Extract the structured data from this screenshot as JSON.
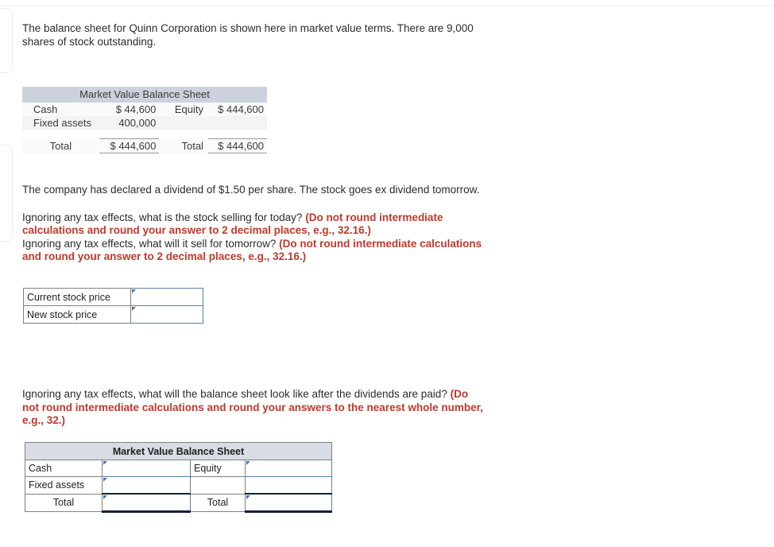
{
  "intro": {
    "text": "The balance sheet for Quinn Corporation is shown here in market value terms. There are 9,000 shares of stock outstanding."
  },
  "balance_sheet_given": {
    "title": "Market Value Balance Sheet",
    "rows": [
      {
        "asset_label": "Cash",
        "asset_value": "$ 44,600",
        "equity_label": "Equity",
        "equity_value": "$ 444,600"
      },
      {
        "asset_label": "Fixed assets",
        "asset_value": "400,000",
        "equity_label": "",
        "equity_value": ""
      }
    ],
    "total": {
      "asset_label": "Total",
      "asset_value": "$ 444,600",
      "equity_label": "Total",
      "equity_value": "$ 444,600"
    }
  },
  "dividend_note": {
    "text": "The company has declared a dividend of $1.50 per share. The stock goes ex dividend tomorrow."
  },
  "question_1": {
    "line_1_plain": "Ignoring any tax effects, what is the stock selling for today? ",
    "line_1_red": "(Do not round intermediate calculations and round your answer to 2 decimal places, e.g., 32.16.)",
    "line_2_plain": "Ignoring any tax effects, what will it sell for tomorrow? ",
    "line_2_red": "(Do not round intermediate calculations and round your answer to 2 decimal places, e.g., 32.16.)"
  },
  "stock_price_table": {
    "rows": [
      {
        "label": "Current stock price",
        "value": ""
      },
      {
        "label": "New stock price",
        "value": ""
      }
    ]
  },
  "question_2": {
    "plain": "Ignoring any tax effects, what will the balance sheet look like after the dividends are paid? ",
    "red": "(Do not round intermediate calculations and round your answers to the nearest whole number, e.g., 32.)"
  },
  "balance_sheet_answer": {
    "title": "Market Value Balance Sheet",
    "rows": [
      {
        "asset_label": "Cash",
        "asset_value": "",
        "equity_label": "Equity",
        "equity_value": ""
      },
      {
        "asset_label": "Fixed assets",
        "asset_value": "",
        "equity_label": "",
        "equity_value": ""
      }
    ],
    "total": {
      "asset_label": "Total",
      "asset_value": "",
      "equity_label": "Total",
      "equity_value": ""
    }
  },
  "colors": {
    "red_emphasis": "#c0392b",
    "header_given": "#ccd2dd",
    "header_answer": "#d7dce5",
    "input_border": "#5b7fa6",
    "input_marker": "#4a72a8",
    "total_rule": "#14213d"
  }
}
